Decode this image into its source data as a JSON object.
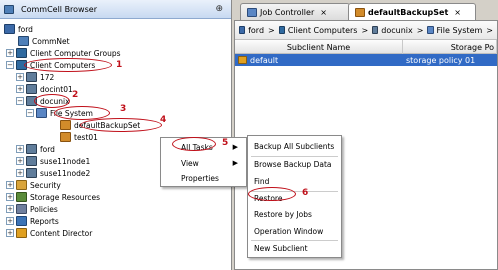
{
  "left": {
    "title": "CommCell Browser",
    "pin": "⊕",
    "tree": [
      {
        "label": "ford",
        "icon": "server-icon"
      },
      {
        "label": "CommNet",
        "icon": "commnet-icon"
      },
      {
        "label": "Client Computer Groups",
        "icon": "group-icon"
      },
      {
        "label": "Client Computers",
        "icon": "group-icon"
      },
      {
        "label": "172",
        "icon": "computer-icon"
      },
      {
        "label": "docint01",
        "icon": "computer-icon"
      },
      {
        "label": "docunix",
        "icon": "computer-icon"
      },
      {
        "label": "File System",
        "icon": "filesystem-icon"
      },
      {
        "label": "defaultBackupSet",
        "icon": "backupset-icon"
      },
      {
        "label": "test01",
        "icon": "backupset-icon"
      },
      {
        "label": "ford",
        "icon": "computer-icon"
      },
      {
        "label": "suse11node1",
        "icon": "computer-icon"
      },
      {
        "label": "suse11node2",
        "icon": "computer-icon"
      },
      {
        "label": "Security",
        "icon": "security-icon"
      },
      {
        "label": "Storage Resources",
        "icon": "storage-icon"
      },
      {
        "label": "Policies",
        "icon": "policies-icon"
      },
      {
        "label": "Reports",
        "icon": "reports-icon"
      },
      {
        "label": "Content Director",
        "icon": "content-director-icon"
      }
    ],
    "steps": [
      "1",
      "2",
      "3",
      "4"
    ]
  },
  "menu1": {
    "items": [
      "All Tasks",
      "View",
      "Properties"
    ],
    "step": "5"
  },
  "menu2": {
    "items": [
      "Backup All Subclients",
      "Browse Backup Data",
      "Find",
      "Restore",
      "Restore by Jobs",
      "Operation Window",
      "New Subclient"
    ],
    "step": "6"
  },
  "tabs": [
    {
      "label": "Job Controller",
      "close": "×"
    },
    {
      "label": "defaultBackupSet",
      "close": "×"
    }
  ],
  "breadcrumb": [
    "ford",
    "Client Computers",
    "docunix",
    "File System",
    ">"
  ],
  "grid": {
    "headers": [
      "Subclient Name",
      "Storage Po"
    ],
    "rows": [
      [
        "default",
        "storage policy 01"
      ]
    ]
  },
  "colors": {
    "annotation": "#c0101a",
    "selection": "#316ac5"
  }
}
